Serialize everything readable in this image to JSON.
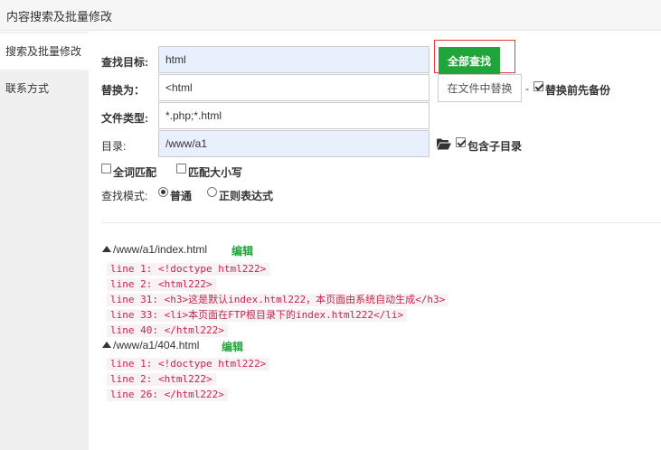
{
  "header": {
    "title": "内容搜索及批量修改"
  },
  "sidebar": {
    "items": [
      {
        "label": "搜索及批量修改"
      },
      {
        "label": "联系方式"
      }
    ]
  },
  "form": {
    "search_label": "查找目标:",
    "search_value": "html",
    "search_all_button": "全部查找",
    "replace_label": "替换为：",
    "replace_value": "<html",
    "replace_in_file_button": "在文件中替换",
    "dash": "-",
    "backup_label": "替换前先备份",
    "backup_checked": true,
    "filetype_label": "文件类型:",
    "filetype_value": "*.php;*.html",
    "dir_label": "目录:",
    "dir_value": "/www/a1",
    "folder_icon": "folder-open-icon",
    "subdir_label": "包含子目录",
    "subdir_checked": true,
    "whole_word_label": "全词匹配",
    "whole_word_checked": false,
    "case_label": "匹配大小写",
    "case_checked": false,
    "mode_label": "查找模式:",
    "mode_options": [
      "普通",
      "正则表达式"
    ],
    "mode_selected": "普通"
  },
  "results": [
    {
      "file": "/www/a1/index.html",
      "edit_label": "编辑",
      "lines": [
        "line 1: <!doctype html222>",
        "line 2: <html222>",
        "line 31: <h3>这是默认index.html222，本页面由系统自动生成</h3>",
        "line 33: <li>本页面在FTP根目录下的index.html222</li>",
        "line 40: </html222>"
      ]
    },
    {
      "file": "/www/a1/404.html",
      "edit_label": "编辑",
      "lines": [
        "line 1: <!doctype html222>",
        "line 2: <html222>",
        "line 26: </html222>"
      ]
    }
  ],
  "colors": {
    "accent": "#20a53a",
    "highlight_border": "#e23b3b",
    "code_text": "#c7254e",
    "code_bg": "#f9f2f4"
  }
}
